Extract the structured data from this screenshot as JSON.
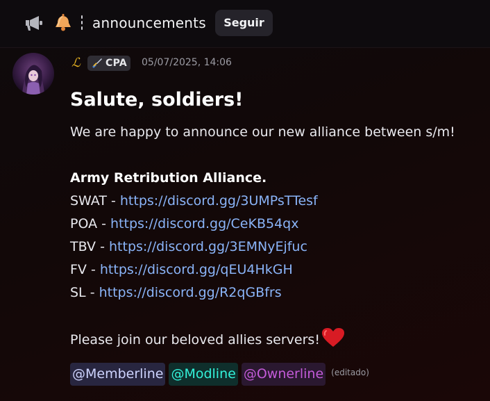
{
  "header": {
    "channel_name": "announcements",
    "follow_label": "Seguir",
    "channel_icon": "megaphone-icon",
    "channel_emoji": "bell-emoji"
  },
  "message": {
    "role_icon": "ℒ",
    "server_tag": "CPA",
    "server_tag_icon": "sword-icon",
    "timestamp": "05/07/2025, 14:06",
    "heading": "Salute, soldiers!",
    "intro": "We are happy to announce our new alliance between s/m!",
    "alliance_title": "Army Retribution Alliance.",
    "alliances": [
      {
        "name": "SWAT",
        "separator": " - ",
        "url": "https://discord.gg/3UMPsTTesf"
      },
      {
        "name": "POA",
        "separator": " - ",
        "url": "https://discord.gg/CeKB54qx"
      },
      {
        "name": "TBV",
        "separator": " - ",
        "url": "https://discord.gg/3EMNyEjfuc"
      },
      {
        "name": "FV",
        "separator": " - ",
        "url": "https://discord.gg/qEU4HkGH"
      },
      {
        "name": "SL",
        "separator": " - ",
        "url": "https://discord.gg/R2qGBfrs"
      }
    ],
    "outro": "Please join our beloved allies servers!",
    "outro_emoji": "heart-emoji",
    "mentions": [
      "@Memberline",
      "@Modline",
      "@Ownerline"
    ],
    "edited_label": "(editado)",
    "colors": {
      "link": "#8ab4f8",
      "mention_member": "#ced4ff",
      "mention_mod": "#33f2da",
      "mention_owner": "#c45bd9",
      "role_icon": "#e8b422"
    }
  }
}
